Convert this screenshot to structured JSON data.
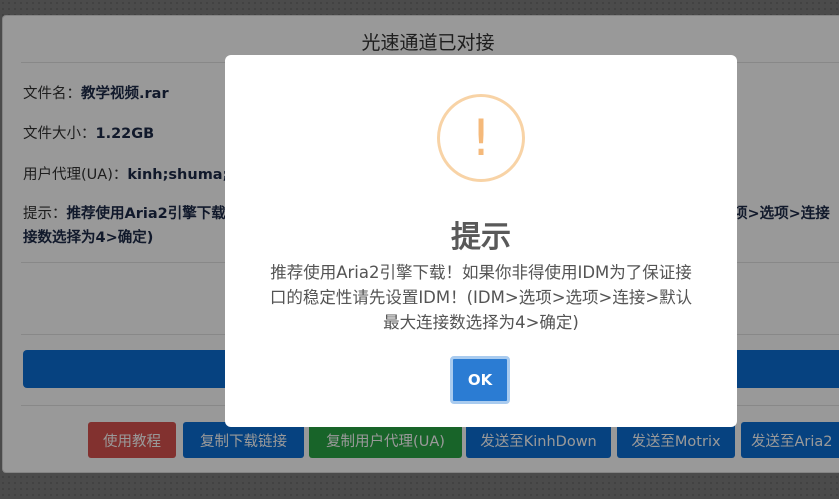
{
  "page": {
    "title": "光速通道已对接",
    "file_name_label": "文件名：",
    "file_name_value": "教学视频.rar",
    "file_size_label": "文件大小：",
    "file_size_value": "1.22GB",
    "ua_label": "用户代理(UA)：",
    "ua_value": "kinh;shuma;",
    "tip_label": "提示：",
    "tip_line1": "推荐使用Aria2引擎下载",
    "tip_line1_right": "项>选项>连接",
    "tip_line2": "接数选择为4>确定)"
  },
  "buttons": [
    {
      "label": "使用教程",
      "color": "#d9534f"
    },
    {
      "label": "复制下载链接",
      "color": "#0b6fd6"
    },
    {
      "label": "复制用户代理(UA)",
      "color": "#28a745"
    },
    {
      "label": "发送至KinhDown",
      "color": "#0b6fd6"
    },
    {
      "label": "发送至Motrix",
      "color": "#0b6fd6"
    },
    {
      "label": "发送至Aria2",
      "color": "#0b6fd6"
    }
  ],
  "modal": {
    "icon": "exclamation-icon",
    "title": "提示",
    "text": "推荐使用Aria2引擎下载！如果你非得使用IDM为了保证接口的稳定性请先设置IDM！(IDM>选项>选项>连接>默认最大连接数选择为4>确定)",
    "ok_label": "OK"
  }
}
